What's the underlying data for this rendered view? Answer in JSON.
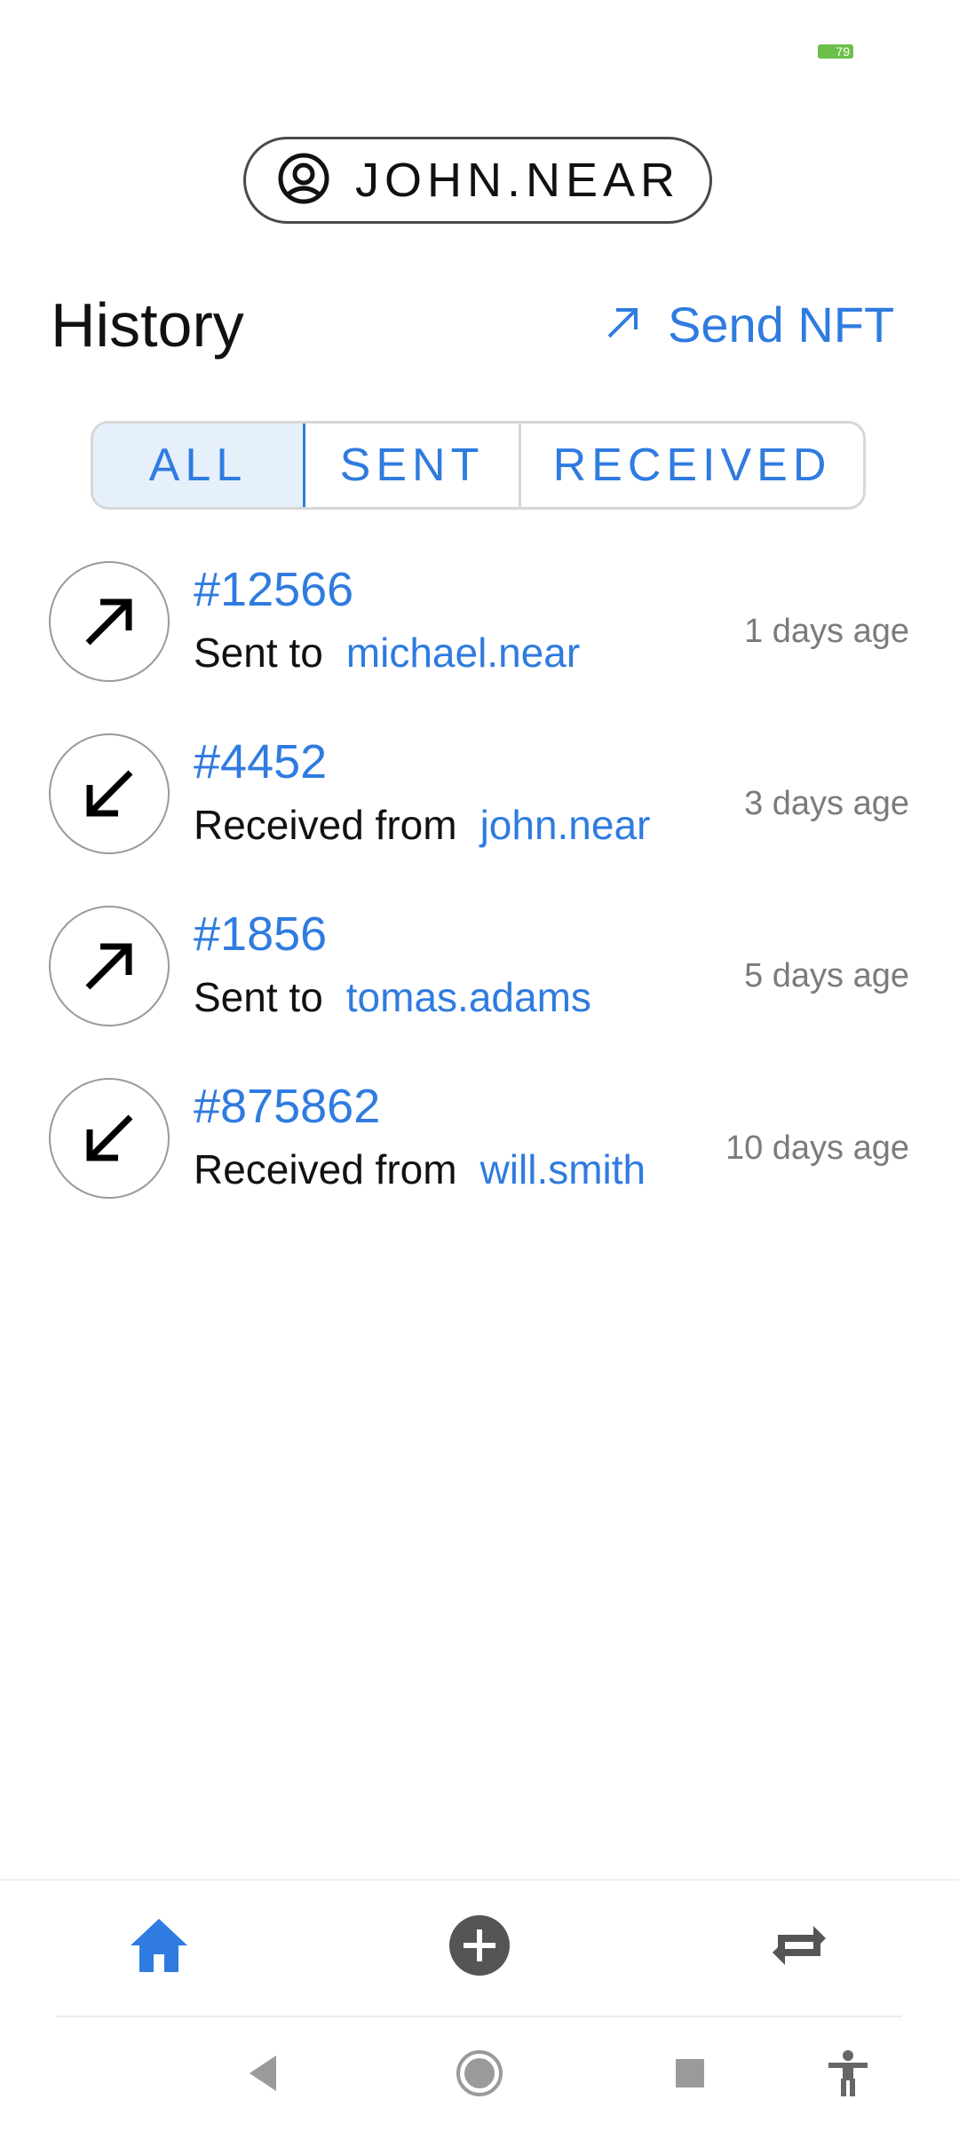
{
  "status_bar": {
    "battery": "79"
  },
  "account": {
    "name": "JOHN.NEAR",
    "icon": "account-circle-icon"
  },
  "header": {
    "title": "History",
    "send_label": "Send NFT",
    "send_icon": "arrow-up-right-icon"
  },
  "tabs": [
    {
      "label": "ALL",
      "selected": true
    },
    {
      "label": "SENT",
      "selected": false
    },
    {
      "label": "RECEIVED",
      "selected": false
    }
  ],
  "history": [
    {
      "id": "#12566",
      "direction": "sent",
      "action": "Sent to",
      "counterparty": "michael.near",
      "time": "1 days age"
    },
    {
      "id": "#4452",
      "direction": "received",
      "action": "Received from",
      "counterparty": "john.near",
      "time": "3 days age"
    },
    {
      "id": "#1856",
      "direction": "sent",
      "action": "Sent to",
      "counterparty": "tomas.adams",
      "time": "5 days age"
    },
    {
      "id": "#875862",
      "direction": "received",
      "action": "Received from",
      "counterparty": "will.smith",
      "time": "10 days age"
    }
  ],
  "bottom_nav": [
    {
      "icon": "home-icon",
      "active": true
    },
    {
      "icon": "plus-circle-icon",
      "active": false
    },
    {
      "icon": "repeat-icon",
      "active": false
    }
  ],
  "system_nav": [
    {
      "icon": "back-icon"
    },
    {
      "icon": "home-circle-icon"
    },
    {
      "icon": "recents-icon"
    },
    {
      "icon": "accessibility-icon"
    }
  ],
  "colors": {
    "accent": "#2f7be0",
    "text": "#111111",
    "muted": "#7b7b7b",
    "battery": "#6cc04a"
  }
}
